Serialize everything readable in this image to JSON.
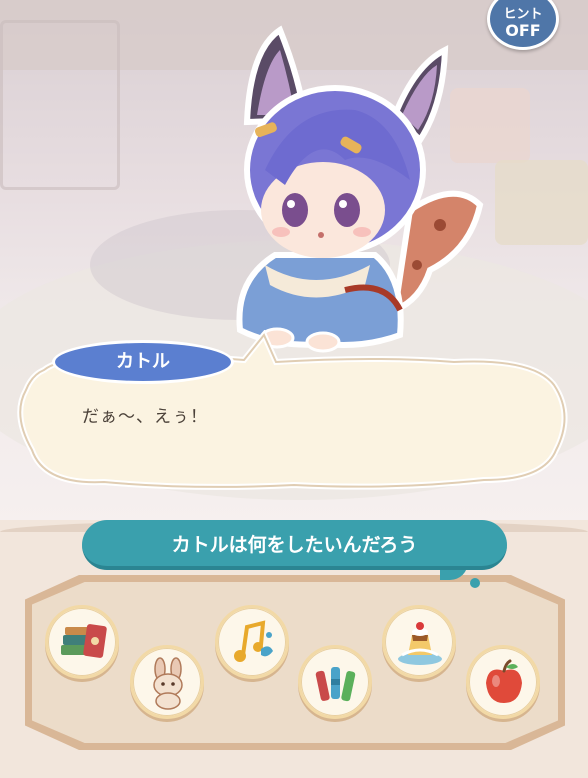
{
  "hint_button": {
    "line1": "ヒント",
    "line2": "OFF"
  },
  "speaker": {
    "name": "カトル"
  },
  "dialogue": {
    "text": "だぁ〜、えぅ！"
  },
  "question": {
    "text": "カトルは何をしたいんだろう"
  },
  "choices": [
    {
      "icon": "books-icon"
    },
    {
      "icon": "bunny-plush-icon"
    },
    {
      "icon": "music-notes-icon"
    },
    {
      "icon": "crayons-icon"
    },
    {
      "icon": "pudding-icon"
    },
    {
      "icon": "apple-icon"
    }
  ],
  "colors": {
    "name_plate": "#5b7fd0",
    "question_banner": "#3aa0ad",
    "hint_button": "#4f76a8",
    "bubble_fill": "#fbf3e1"
  }
}
